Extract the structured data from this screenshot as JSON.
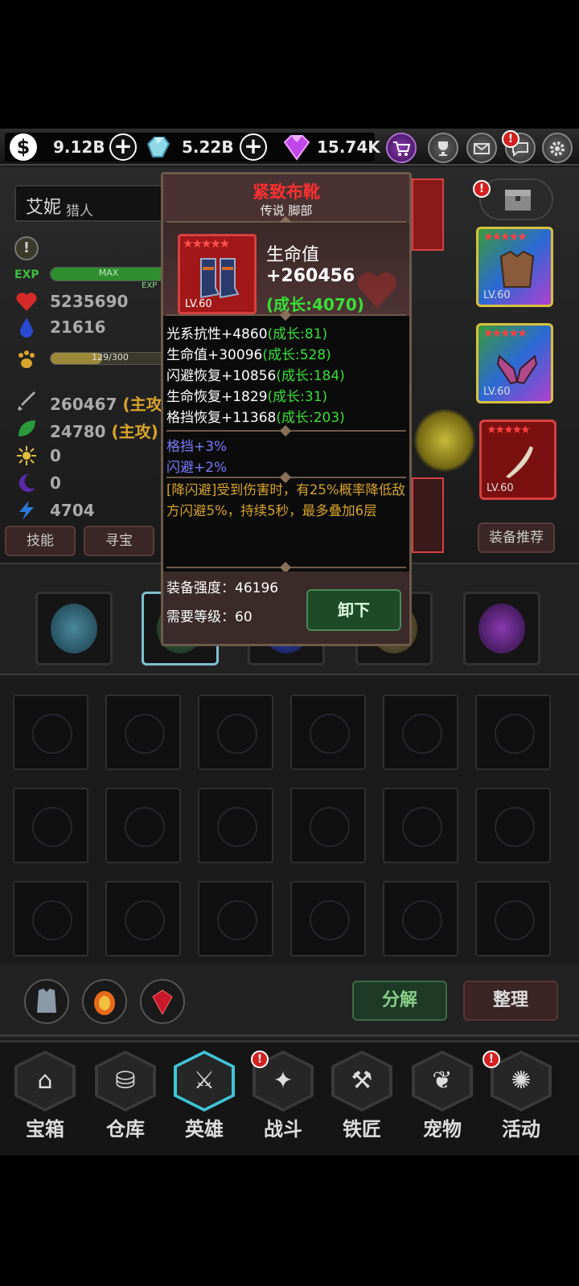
{
  "currency": {
    "gold_icon": "$",
    "gold": "9.12B",
    "crystal": "5.22B",
    "gem": "15.74K",
    "plus": "+"
  },
  "top_buttons": {
    "shop_icon": "cart-icon",
    "trophy_icon": "trophy-icon",
    "mail_icon": "mail-icon",
    "chat_icon": "chat-icon",
    "settings_icon": "gear-icon",
    "alert": "!"
  },
  "hero": {
    "name": "艾妮",
    "class": "猎人",
    "exp_label": "EXP",
    "exp_text": "MAX",
    "exp_small": "EXP",
    "pet_progress": "129/300",
    "pet_fraction": 0.43,
    "stats": [
      {
        "icon": "heart-icon",
        "value": "5235690",
        "tag": ""
      },
      {
        "icon": "mana-drop-icon",
        "value": "21616",
        "tag": ""
      },
      {
        "icon": "sword-icon",
        "value": "260467 ",
        "tag": "(主攻"
      },
      {
        "icon": "leaf-icon",
        "value": "24780 ",
        "tag": "(主攻)"
      },
      {
        "icon": "sun-icon",
        "value": "0",
        "tag": ""
      },
      {
        "icon": "moon-icon",
        "value": "0",
        "tag": ""
      },
      {
        "icon": "bolt-icon",
        "value": "4704",
        "tag": ""
      }
    ],
    "tabs": [
      "技能",
      "寻宝"
    ],
    "recommend": "装备推荐",
    "alert": "!"
  },
  "equipment_slots": [
    {
      "level": "LV.60",
      "stars": "★★★★★"
    },
    {
      "level": "LV.60",
      "stars": "★★★★★"
    },
    {
      "level": "LV.60",
      "stars": "★★★★★"
    }
  ],
  "actions": {
    "decompose": "分解",
    "sort": "整理"
  },
  "nav": [
    {
      "label": "宝箱",
      "icon": "chest-icon",
      "glyph": "⌂"
    },
    {
      "label": "仓库",
      "icon": "backpack-icon",
      "glyph": "⛁"
    },
    {
      "label": "英雄",
      "icon": "hero-icon",
      "glyph": "⚔"
    },
    {
      "label": "战斗",
      "icon": "battle-icon",
      "glyph": "✦"
    },
    {
      "label": "铁匠",
      "icon": "anvil-icon",
      "glyph": "⚒"
    },
    {
      "label": "宠物",
      "icon": "pet-icon",
      "glyph": "❦"
    },
    {
      "label": "活动",
      "icon": "event-icon",
      "glyph": "✺"
    }
  ],
  "tooltip": {
    "title": "紧致布靴",
    "subtitle": "传说 脚部",
    "item_level": "LV.60",
    "item_stars": "★★★★★",
    "main_stat_name": "生命值",
    "main_stat_value": "+260456",
    "main_stat_growth": "(成长:4070)",
    "sub_stats": [
      {
        "text": "光系抗性+4860",
        "growth": "(成长:81)"
      },
      {
        "text": "生命值+30096",
        "growth": "(成长:528)"
      },
      {
        "text": "闪避恢复+10856",
        "growth": "(成长:184)"
      },
      {
        "text": "生命恢复+1829",
        "growth": "(成长:31)"
      },
      {
        "text": "格挡恢复+11368",
        "growth": "(成长:203)"
      }
    ],
    "bonuses": [
      "格挡+3%",
      "闪避+2%"
    ],
    "skill": "[降闪避]受到伤害时，有25%概率降低敌方闪避5%，持续5秒，最多叠加6层",
    "power": "装备强度：46196",
    "level_req": "需要等级：60",
    "unequip": "卸下"
  }
}
